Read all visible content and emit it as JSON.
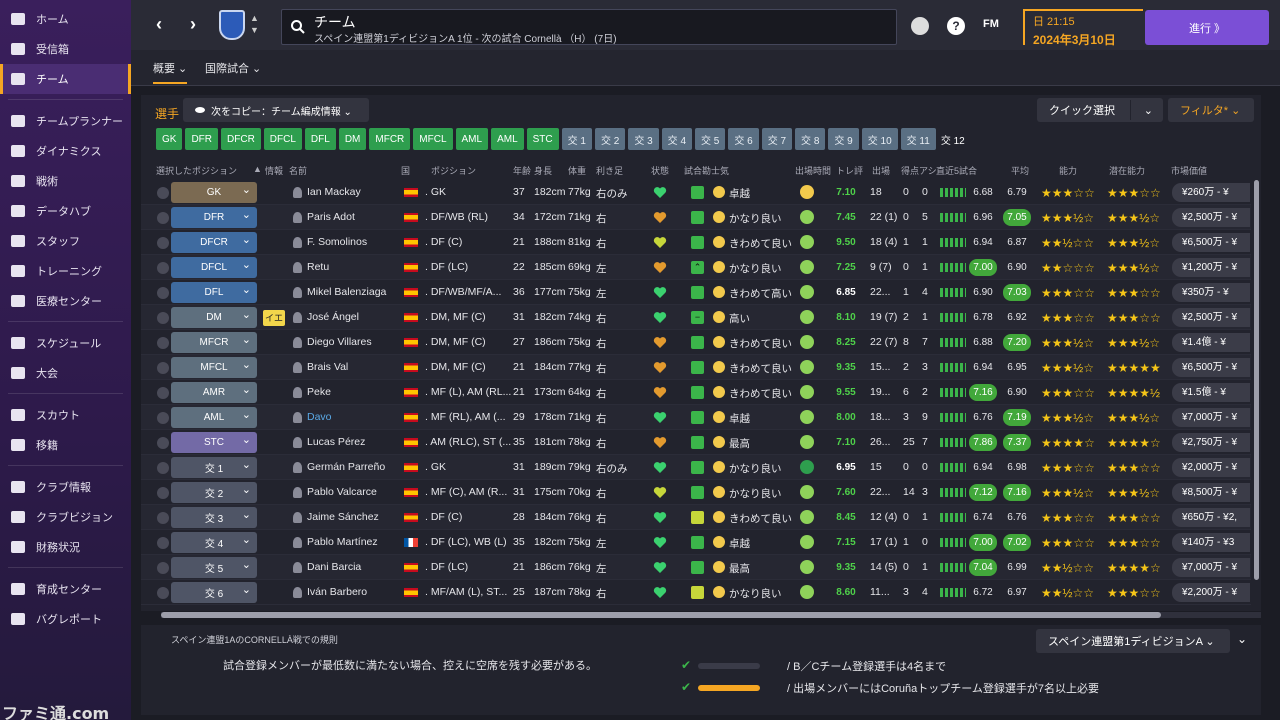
{
  "sidebar": {
    "items": [
      {
        "label": "ホーム",
        "icon": "home-icon"
      },
      {
        "label": "受信箱",
        "icon": "inbox-icon"
      },
      {
        "label": "チーム",
        "icon": "shirt-icon",
        "active": true
      },
      {
        "label": "チームプランナー",
        "icon": "planner-icon"
      },
      {
        "label": "ダイナミクス",
        "icon": "dynamics-icon"
      },
      {
        "label": "戦術",
        "icon": "tactics-icon"
      },
      {
        "label": "データハブ",
        "icon": "data-hub-icon"
      },
      {
        "label": "スタッフ",
        "icon": "staff-icon"
      },
      {
        "label": "トレーニング",
        "icon": "training-icon"
      },
      {
        "label": "医療センター",
        "icon": "medical-icon"
      },
      {
        "label": "スケジュール",
        "icon": "calendar-icon"
      },
      {
        "label": "大会",
        "icon": "trophy-icon"
      },
      {
        "label": "スカウト",
        "icon": "scout-icon"
      },
      {
        "label": "移籍",
        "icon": "transfer-icon"
      },
      {
        "label": "クラブ情報",
        "icon": "club-info-icon"
      },
      {
        "label": "クラブビジョン",
        "icon": "club-vision-icon"
      },
      {
        "label": "財務状況",
        "icon": "finance-icon"
      },
      {
        "label": "育成センター",
        "icon": "development-icon"
      },
      {
        "label": "バグレポート",
        "icon": "bug-report-icon"
      }
    ]
  },
  "topbar": {
    "title": "チーム",
    "subtitle": "スペイン連盟第1ディビジョンA 1位 - 次の試合 Cornellà （H） (7日)",
    "fm_label": "FM",
    "time": "日 21:15",
    "date": "2024年3月10日",
    "continue_label": "進行 》"
  },
  "subtabs": [
    "概要 ⌄",
    "国際試合 ⌄"
  ],
  "main": {
    "players_label": "選手",
    "copy_label": "次をコピー：チーム編成情報 ⌄",
    "quick_label": "クイック選択",
    "filter_label": "フィルタ*  ⌄",
    "position_buttons": [
      {
        "label": "GK",
        "filled": true
      },
      {
        "label": "DFR",
        "filled": true
      },
      {
        "label": "DFCR",
        "filled": true
      },
      {
        "label": "DFCL",
        "filled": true
      },
      {
        "label": "DFL",
        "filled": true
      },
      {
        "label": "DM",
        "filled": true
      },
      {
        "label": "MFCR",
        "filled": true
      },
      {
        "label": "MFCL",
        "filled": true
      },
      {
        "label": "AML",
        "filled": true
      },
      {
        "label": "AML",
        "filled": true
      },
      {
        "label": "STC",
        "filled": true
      },
      {
        "label": "交 1",
        "filled": false
      },
      {
        "label": "交 2",
        "filled": false
      },
      {
        "label": "交 3",
        "filled": false
      },
      {
        "label": "交 4",
        "filled": false
      },
      {
        "label": "交 5",
        "filled": false
      },
      {
        "label": "交 6",
        "filled": false
      },
      {
        "label": "交 7",
        "filled": false
      },
      {
        "label": "交 8",
        "filled": false
      },
      {
        "label": "交 9",
        "filled": false
      },
      {
        "label": "交 10",
        "filled": false
      },
      {
        "label": "交 11",
        "filled": false
      },
      {
        "label": "交 12",
        "filled": null
      }
    ],
    "columns": {
      "selected_position": "選択したポジション",
      "sort_arrow": "▲",
      "info": "情報",
      "name": "名前",
      "nation": "国",
      "position": "ポジション",
      "age": "年齢",
      "height": "身長",
      "weight": "体重",
      "foot": "利き足",
      "condition": "状態",
      "match_fitness": "試合勘",
      "morale": "士気",
      "playing_time": "出場時間",
      "training_rating": "トレ評",
      "apps": "出場",
      "goals": "得点",
      "assists": "アシ",
      "last5": "直近5試合",
      "average": "平均",
      "ability": "能力",
      "potential": "潜在能力",
      "value": "市場価値"
    },
    "rows": [
      {
        "slot": "GK",
        "slot_type": "gk",
        "info": "",
        "name": "Ian Mackay",
        "nation": "es",
        "position": ". GK",
        "age": "37",
        "height": "182cm",
        "weight": "77kg",
        "foot": "右のみ",
        "heart": "green",
        "fit": "green",
        "morale": "卓越",
        "face": "yellow",
        "training": "7.10",
        "training_color": "green",
        "apps": "18",
        "goals": "0",
        "assists": "0",
        "last5": "6.68",
        "last5_hl": false,
        "avg": "6.79",
        "avg_hl": false,
        "ability": "★★★☆☆",
        "potential": "★★★☆☆",
        "value": "¥260万 - ¥"
      },
      {
        "slot": "DFR",
        "slot_type": "def",
        "info": "",
        "name": "Paris Adot",
        "nation": "es",
        "position": ". DF/WB (RL)",
        "age": "34",
        "height": "172cm",
        "weight": "71kg",
        "foot": "右",
        "heart": "orange",
        "fit": "green",
        "morale": "かなり良い",
        "face": "green",
        "training": "7.45",
        "training_color": "green",
        "apps": "22 (1)",
        "goals": "0",
        "assists": "5",
        "last5": "6.96",
        "last5_hl": false,
        "avg": "7.05",
        "avg_hl": true,
        "ability": "★★★½☆",
        "potential": "★★★½☆",
        "value": "¥2,500万 - ¥"
      },
      {
        "slot": "DFCR",
        "slot_type": "def",
        "info": "",
        "name": "F. Somolinos",
        "nation": "es",
        "position": ". DF (C)",
        "age": "21",
        "height": "188cm",
        "weight": "81kg",
        "foot": "右",
        "heart": "yellow",
        "fit": "green",
        "morale": "きわめて良い",
        "face": "green",
        "training": "9.50",
        "training_color": "green",
        "apps": "18 (4)",
        "goals": "1",
        "assists": "1",
        "last5": "6.94",
        "last5_hl": false,
        "avg": "6.87",
        "avg_hl": false,
        "ability": "★★½☆☆",
        "potential": "★★★½☆",
        "value": "¥6,500万 - ¥"
      },
      {
        "slot": "DFCL",
        "slot_type": "def",
        "info": "",
        "name": "Retu",
        "nation": "es",
        "position": ". DF (LC)",
        "age": "22",
        "height": "185cm",
        "weight": "69kg",
        "foot": "左",
        "heart": "orange",
        "fit": "up",
        "morale": "かなり良い",
        "face": "green",
        "training": "7.25",
        "training_color": "green",
        "apps": "9 (7)",
        "goals": "0",
        "assists": "1",
        "last5": "7.00",
        "last5_hl": true,
        "avg": "6.90",
        "avg_hl": false,
        "ability": "★★☆☆☆",
        "potential": "★★★½☆",
        "value": "¥1,200万 - ¥"
      },
      {
        "slot": "DFL",
        "slot_type": "def",
        "info": "",
        "name": "Mikel Balenziaga",
        "nation": "es",
        "position": ". DF/WB/MF/A...",
        "age": "36",
        "height": "177cm",
        "weight": "75kg",
        "foot": "左",
        "heart": "green",
        "fit": "green",
        "morale": "きわめて高い",
        "face": "green",
        "training": "6.85",
        "training_color": "white",
        "apps": "22...",
        "goals": "1",
        "assists": "4",
        "last5": "6.90",
        "last5_hl": false,
        "avg": "7.03",
        "avg_hl": true,
        "ability": "★★★☆☆",
        "potential": "★★★☆☆",
        "value": "¥350万 - ¥"
      },
      {
        "slot": "DM",
        "slot_type": "mid",
        "info": "イエ",
        "name": "José Ángel",
        "nation": "es",
        "position": ". DM, MF (C)",
        "age": "31",
        "height": "182cm",
        "weight": "74kg",
        "foot": "右",
        "heart": "green",
        "fit": "minus",
        "morale": "高い",
        "face": "green",
        "training": "8.10",
        "training_color": "green",
        "apps": "19 (7)",
        "goals": "2",
        "assists": "1",
        "last5": "6.78",
        "last5_hl": false,
        "avg": "6.92",
        "avg_hl": false,
        "ability": "★★★☆☆",
        "potential": "★★★☆☆",
        "value": "¥2,500万 - ¥"
      },
      {
        "slot": "MFCR",
        "slot_type": "mid",
        "info": "",
        "name": "Diego Villares",
        "nation": "es",
        "position": ". DM, MF (C)",
        "age": "27",
        "height": "186cm",
        "weight": "75kg",
        "foot": "右",
        "heart": "orange",
        "fit": "green",
        "morale": "きわめて良い",
        "face": "green",
        "training": "8.25",
        "training_color": "green",
        "apps": "22 (7)",
        "goals": "8",
        "assists": "7",
        "last5": "6.88",
        "last5_hl": false,
        "avg": "7.20",
        "avg_hl": true,
        "ability": "★★★½☆",
        "potential": "★★★½☆",
        "value": "¥1.4億 - ¥"
      },
      {
        "slot": "MFCL",
        "slot_type": "mid",
        "info": "",
        "name": "Brais Val",
        "nation": "es",
        "position": ". DM, MF (C)",
        "age": "21",
        "height": "184cm",
        "weight": "77kg",
        "foot": "右",
        "heart": "orange",
        "fit": "green",
        "morale": "きわめて良い",
        "face": "green",
        "training": "9.35",
        "training_color": "green",
        "apps": "15...",
        "goals": "2",
        "assists": "3",
        "last5": "6.94",
        "last5_hl": false,
        "avg": "6.95",
        "avg_hl": false,
        "ability": "★★★½☆",
        "potential": "★★★★★",
        "value": "¥6,500万 - ¥"
      },
      {
        "slot": "AMR",
        "slot_type": "mid",
        "info": "",
        "name": "Peke",
        "nation": "es",
        "position": ". MF (L), AM (RL...",
        "age": "21",
        "height": "173cm",
        "weight": "64kg",
        "foot": "右",
        "heart": "orange",
        "fit": "green",
        "morale": "きわめて良い",
        "face": "green",
        "training": "9.55",
        "training_color": "green",
        "apps": "19...",
        "goals": "6",
        "assists": "2",
        "last5": "7.16",
        "last5_hl": true,
        "avg": "6.90",
        "avg_hl": false,
        "ability": "★★★☆☆",
        "potential": "★★★★½",
        "value": "¥1.5億 - ¥"
      },
      {
        "slot": "AML",
        "slot_type": "mid",
        "info": "",
        "name": "Davo",
        "name_color": "#5aa9e6",
        "nation": "es",
        "position": ". MF (RL), AM (...",
        "age": "29",
        "height": "178cm",
        "weight": "71kg",
        "foot": "右",
        "heart": "green",
        "fit": "green",
        "morale": "卓越",
        "face": "green",
        "training": "8.00",
        "training_color": "green",
        "apps": "18...",
        "goals": "3",
        "assists": "9",
        "last5": "6.76",
        "last5_hl": false,
        "avg": "7.19",
        "avg_hl": true,
        "ability": "★★★½☆",
        "potential": "★★★½☆",
        "value": "¥7,000万 - ¥"
      },
      {
        "slot": "STC",
        "slot_type": "att",
        "info": "",
        "name": "Lucas Pérez",
        "nation": "es",
        "position": ". AM (RLC), ST (...",
        "age": "35",
        "height": "181cm",
        "weight": "78kg",
        "foot": "右",
        "heart": "orange",
        "fit": "green",
        "morale": "最高",
        "face": "green",
        "training": "7.10",
        "training_color": "green",
        "apps": "26...",
        "goals": "25",
        "assists": "7",
        "last5": "7.86",
        "last5_hl": true,
        "avg": "7.37",
        "avg_hl": true,
        "ability": "★★★★☆",
        "potential": "★★★★☆",
        "value": "¥2,750万 - ¥"
      },
      {
        "slot": "交 1",
        "slot_type": "sub",
        "info": "",
        "name": "Germán Parreño",
        "nation": "es",
        "position": ". GK",
        "age": "31",
        "height": "189cm",
        "weight": "79kg",
        "foot": "右のみ",
        "heart": "green",
        "fit": "green",
        "morale": "かなり良い",
        "face": "dgreen",
        "training": "6.95",
        "training_color": "white",
        "apps": "15",
        "goals": "0",
        "assists": "0",
        "last5": "6.94",
        "last5_hl": false,
        "avg": "6.98",
        "avg_hl": false,
        "ability": "★★★☆☆",
        "potential": "★★★☆☆",
        "value": "¥2,000万 - ¥"
      },
      {
        "slot": "交 2",
        "slot_type": "sub",
        "info": "",
        "name": "Pablo Valcarce",
        "nation": "es",
        "position": ". MF (C), AM (R...",
        "age": "31",
        "height": "175cm",
        "weight": "70kg",
        "foot": "右",
        "heart": "yellow",
        "fit": "green",
        "morale": "かなり良い",
        "face": "green",
        "training": "7.60",
        "training_color": "green",
        "apps": "22...",
        "goals": "14",
        "assists": "3",
        "last5": "7.12",
        "last5_hl": true,
        "avg": "7.16",
        "avg_hl": true,
        "ability": "★★★½☆",
        "potential": "★★★½☆",
        "value": "¥8,500万 - ¥"
      },
      {
        "slot": "交 3",
        "slot_type": "sub",
        "info": "",
        "name": "Jaime Sánchez",
        "nation": "es",
        "position": ". DF (C)",
        "age": "28",
        "height": "184cm",
        "weight": "76kg",
        "foot": "右",
        "heart": "green",
        "fit": "yellow",
        "morale": "きわめて良い",
        "face": "green",
        "training": "8.45",
        "training_color": "green",
        "apps": "12 (4)",
        "goals": "0",
        "assists": "1",
        "last5": "6.74",
        "last5_hl": false,
        "avg": "6.76",
        "avg_hl": false,
        "ability": "★★★☆☆",
        "potential": "★★★☆☆",
        "value": "¥650万 - ¥2,"
      },
      {
        "slot": "交 4",
        "slot_type": "sub",
        "info": "",
        "name": "Pablo Martínez",
        "nation": "fr",
        "position": ". DF (LC), WB (L)",
        "age": "35",
        "height": "182cm",
        "weight": "75kg",
        "foot": "左",
        "heart": "green",
        "fit": "green",
        "morale": "卓越",
        "face": "green",
        "training": "7.15",
        "training_color": "green",
        "apps": "17 (1)",
        "goals": "1",
        "assists": "0",
        "last5": "7.00",
        "last5_hl": true,
        "avg": "7.02",
        "avg_hl": true,
        "ability": "★★★☆☆",
        "potential": "★★★☆☆",
        "value": "¥140万 - ¥3"
      },
      {
        "slot": "交 5",
        "slot_type": "sub",
        "info": "",
        "name": "Dani Barcia",
        "nation": "es",
        "position": ". DF (LC)",
        "age": "21",
        "height": "186cm",
        "weight": "76kg",
        "foot": "左",
        "heart": "green",
        "fit": "green",
        "morale": "最高",
        "face": "green",
        "training": "9.35",
        "training_color": "green",
        "apps": "14 (5)",
        "goals": "0",
        "assists": "1",
        "last5": "7.04",
        "last5_hl": true,
        "avg": "6.99",
        "avg_hl": false,
        "ability": "★★½☆☆",
        "potential": "★★★★☆",
        "value": "¥7,000万 - ¥"
      },
      {
        "slot": "交 6",
        "slot_type": "sub",
        "info": "",
        "name": "Iván Barbero",
        "nation": "es",
        "position": ". MF/AM (L), ST...",
        "age": "25",
        "height": "187cm",
        "weight": "78kg",
        "foot": "右",
        "heart": "green",
        "fit": "yellow",
        "morale": "かなり良い",
        "face": "green",
        "training": "8.60",
        "training_color": "green",
        "apps": "11...",
        "goals": "3",
        "assists": "4",
        "last5": "6.72",
        "last5_hl": false,
        "avg": "6.97",
        "avg_hl": false,
        "ability": "★★½☆☆",
        "potential": "★★★☆☆",
        "value": "¥2,200万 - ¥"
      }
    ]
  },
  "rules": {
    "title": "スペイン連盟1AのCORNELLÀ戦での規則",
    "warning": "試合登録メンバーが最低数に満たない場合、控えに空席を残す必要がある。",
    "league": "スペイン連盟第1ディビジョンA ⌄",
    "chevron": "⌄",
    "lines": [
      {
        "text": "/  B／Cチーム登録選手は4名まで",
        "bar_color": "#3a3b48"
      },
      {
        "text": "/  出場メンバーにはCoruñaトップチーム登録選手が7名以上必要",
        "bar_color": "#f5a623"
      }
    ]
  },
  "corner_logo": "ファミ通.com",
  "colors": {
    "accent": "#f5a623",
    "primary": "#7b4fd6",
    "green": "#3bb54a"
  }
}
